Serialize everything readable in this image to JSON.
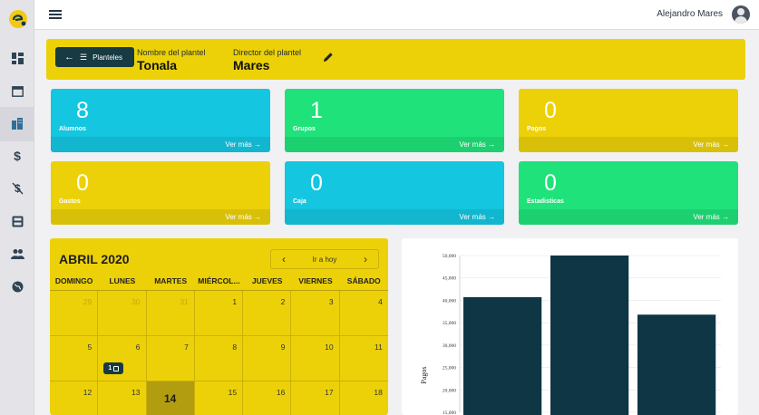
{
  "topbar": {
    "username": "Alejandro Mares"
  },
  "banner": {
    "back_button_label": "Planteles",
    "plantel_label": "Nombre del plantel",
    "plantel_value": "Tonala",
    "director_label": "Director del plantel",
    "director_value": "Mares"
  },
  "cards": [
    {
      "value": "8",
      "label": "Alumnos",
      "more": "Ver más →"
    },
    {
      "value": "1",
      "label": "Grupos",
      "more": "Ver más →"
    },
    {
      "value": "0",
      "label": "Pagos",
      "more": "Ver más →"
    },
    {
      "value": "0",
      "label": "Gastos",
      "more": "Ver más →"
    },
    {
      "value": "0",
      "label": "Caja",
      "more": "Ver más →"
    },
    {
      "value": "0",
      "label": "Estadisticas",
      "more": "Ver más →"
    }
  ],
  "calendar": {
    "title": "ABRIL 2020",
    "today_button": "Ir a hoy",
    "weekdays": [
      "DOMINGO",
      "LUNES",
      "MARTES",
      "MIÉRCOL...",
      "JUEVES",
      "VIERNES",
      "SÁBADO"
    ],
    "rows": [
      [
        "29",
        "30",
        "31",
        "1",
        "2",
        "3",
        "4"
      ],
      [
        "5",
        "6",
        "7",
        "8",
        "9",
        "10",
        "11"
      ],
      [
        "12",
        "13",
        "14",
        "15",
        "16",
        "17",
        "18"
      ]
    ],
    "event_count": "1"
  },
  "chart_data": {
    "type": "bar",
    "categories": [
      "",
      "",
      ""
    ],
    "values": [
      40700,
      50000,
      36800
    ],
    "ylabel": "Pagos",
    "ylim": [
      15000,
      50000
    ],
    "yticks": [
      "50,000",
      "45,000",
      "40,000",
      "35,000",
      "30,000",
      "25,000",
      "20,000",
      "15,000"
    ],
    "bar_color": "#0f3644",
    "grid": true
  },
  "colors": {
    "yellow": "#ecd109",
    "cyan": "#14c6e0",
    "green": "#1fe27a",
    "navy": "#173a43"
  }
}
